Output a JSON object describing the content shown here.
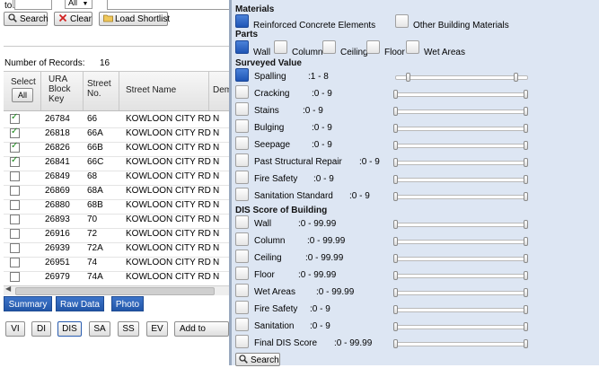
{
  "colors": {
    "accent": "#2a5db0",
    "panel": "#dde6f3",
    "check": "#1a8a1a"
  },
  "left": {
    "to_label": "to",
    "all_select_value": "All",
    "search_label": "Search",
    "clear_label": "Clear",
    "load_shortlist_label": "Load Shortlist",
    "records_label": "Number of Records:",
    "records_count": "16",
    "headers": {
      "select": "Select",
      "all_btn": "All",
      "ura_l1": "URA",
      "ura_l2": "Block",
      "ura_l3": "Key",
      "street_no_l1": "Street",
      "street_no_l2": "No.",
      "street_name": "Street Name",
      "dem": "Dem"
    },
    "rows": [
      {
        "checked": true,
        "key": "26784",
        "no": "66",
        "name": "KOWLOON CITY RD",
        "dem": "N"
      },
      {
        "checked": true,
        "key": "26818",
        "no": "66A",
        "name": "KOWLOON CITY RD",
        "dem": "N"
      },
      {
        "checked": true,
        "key": "26826",
        "no": "66B",
        "name": "KOWLOON CITY RD",
        "dem": "N"
      },
      {
        "checked": true,
        "key": "26841",
        "no": "66C",
        "name": "KOWLOON CITY RD",
        "dem": "N"
      },
      {
        "checked": false,
        "key": "26849",
        "no": "68",
        "name": "KOWLOON CITY RD",
        "dem": "N"
      },
      {
        "checked": false,
        "key": "26869",
        "no": "68A",
        "name": "KOWLOON CITY RD",
        "dem": "N"
      },
      {
        "checked": false,
        "key": "26880",
        "no": "68B",
        "name": "KOWLOON CITY RD",
        "dem": "N"
      },
      {
        "checked": false,
        "key": "26893",
        "no": "70",
        "name": "KOWLOON CITY RD",
        "dem": "N"
      },
      {
        "checked": false,
        "key": "26916",
        "no": "72",
        "name": "KOWLOON CITY RD",
        "dem": "N"
      },
      {
        "checked": false,
        "key": "26939",
        "no": "72A",
        "name": "KOWLOON CITY RD",
        "dem": "N"
      },
      {
        "checked": false,
        "key": "26951",
        "no": "74",
        "name": "KOWLOON CITY RD",
        "dem": "N"
      },
      {
        "checked": false,
        "key": "26979",
        "no": "74A",
        "name": "KOWLOON CITY RD",
        "dem": "N"
      }
    ],
    "tabs": {
      "summary": "Summary",
      "raw_data": "Raw Data",
      "photo": "Photo"
    },
    "small_btns": {
      "vi": "VI",
      "di": "DI",
      "dis": "DIS",
      "sa": "SA",
      "ss": "SS",
      "ev": "EV",
      "add": "Add to Shortlis"
    }
  },
  "right": {
    "materials_title": "Materials",
    "materials": [
      {
        "label": "Reinforced Concrete Elements",
        "selected": true
      },
      {
        "label": "Other Building Materials",
        "selected": false
      }
    ],
    "parts_title": "Parts",
    "parts": [
      {
        "label": "Wall",
        "selected": true
      },
      {
        "label": "Column",
        "selected": false
      },
      {
        "label": "Ceiling",
        "selected": false
      },
      {
        "label": "Floor",
        "selected": false
      },
      {
        "label": "Wet Areas",
        "selected": false
      }
    ],
    "surveyed_title": "Surveyed Value",
    "surveyed": [
      {
        "label": "Spalling",
        "range": ":1 - 8",
        "selected": true
      },
      {
        "label": "Cracking",
        "range": ":0 - 9",
        "selected": false
      },
      {
        "label": "Stains",
        "range": ":0 - 9",
        "selected": false
      },
      {
        "label": "Bulging",
        "range": ":0 - 9",
        "selected": false
      },
      {
        "label": "Seepage",
        "range": ":0 - 9",
        "selected": false
      },
      {
        "label": "Past Structural Repair",
        "range": ":0 - 9",
        "selected": false
      },
      {
        "label": "Fire Safety",
        "range": ":0 - 9",
        "selected": false
      },
      {
        "label": "Sanitation Standard",
        "range": ":0 - 9",
        "selected": false
      }
    ],
    "dis_title": "DIS Score of Building",
    "dis": [
      {
        "label": "Wall",
        "range": ":0 - 99.99"
      },
      {
        "label": "Column",
        "range": ":0 - 99.99"
      },
      {
        "label": "Ceiling",
        "range": ":0 - 99.99"
      },
      {
        "label": "Floor",
        "range": ":0 - 99.99"
      },
      {
        "label": "Wet Areas",
        "range": ":0 - 99.99"
      },
      {
        "label": "Fire Safety",
        "range": ":0 - 9"
      },
      {
        "label": "Sanitation",
        "range": ":0 - 9"
      },
      {
        "label": "Final DIS Score",
        "range": ":0 - 99.99"
      }
    ],
    "search_label": "Search"
  }
}
